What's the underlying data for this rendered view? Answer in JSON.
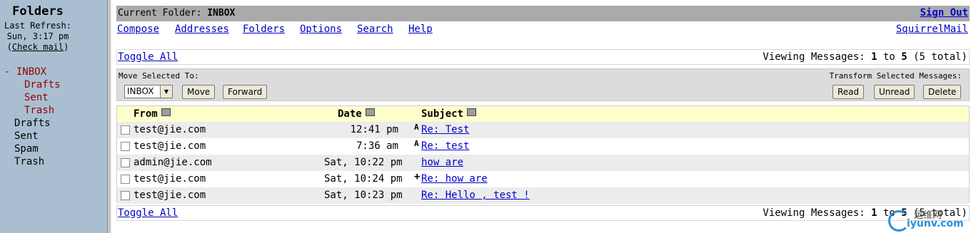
{
  "sidebar": {
    "title": "Folders",
    "last_refresh_label": "Last Refresh:",
    "last_refresh_time": "Sun, 3:17 pm",
    "check_mail_open": "(",
    "check_mail_label": "Check mail",
    "check_mail_close": ")",
    "folders": [
      {
        "prefix": "- ",
        "label": "INBOX",
        "current": true
      },
      {
        "prefix": "",
        "label": "Drafts",
        "current": false
      },
      {
        "prefix": "",
        "label": "Sent",
        "current": false
      },
      {
        "prefix": "",
        "label": "Trash",
        "current": false
      },
      {
        "prefix": "",
        "label": "Drafts",
        "current": false
      },
      {
        "prefix": "",
        "label": "Sent",
        "current": false
      },
      {
        "prefix": "",
        "label": "Spam",
        "current": false
      },
      {
        "prefix": "",
        "label": "Trash",
        "current": false
      }
    ]
  },
  "header": {
    "current_folder_label": "Current Folder:",
    "current_folder": "INBOX",
    "sign_out": "Sign Out",
    "nav": [
      "Compose",
      "Addresses",
      "Folders",
      "Options",
      "Search",
      "Help"
    ],
    "brand_link": "SquirrelMail"
  },
  "list_controls": {
    "toggle_all": "Toggle All",
    "viewing_prefix": "Viewing Messages: ",
    "viewing_from": "1",
    "viewing_to_word": " to ",
    "viewing_to": "5",
    "viewing_total": " (5 total)"
  },
  "operations": {
    "move_label": "Move Selected To:",
    "move_target": "INBOX",
    "move_button": "Move",
    "forward_button": "Forward",
    "transform_label": "Transform Selected Messages:",
    "read_button": "Read",
    "unread_button": "Unread",
    "delete_button": "Delete"
  },
  "table": {
    "headers": {
      "from": "From",
      "date": "Date",
      "subject": "Subject"
    },
    "rows": [
      {
        "from": "test@jie.com",
        "date": "12:41 pm",
        "flag": "A",
        "subject": "Re: Test",
        "shaded": true
      },
      {
        "from": "test@jie.com",
        "date": "7:36 am",
        "flag": "A",
        "subject": "Re: test",
        "shaded": false
      },
      {
        "from": "admin@jie.com",
        "date": "Sat, 10:22 pm",
        "flag": "",
        "subject": "how are",
        "shaded": true
      },
      {
        "from": "test@jie.com",
        "date": "Sat, 10:24 pm",
        "flag": "+",
        "subject": "Re: how are",
        "shaded": false
      },
      {
        "from": "test@jie.com",
        "date": "Sat, 10:23 pm",
        "flag": "",
        "subject": "Re: Hello , test !",
        "shaded": true
      }
    ]
  },
  "watermark": {
    "line1": "运维网",
    "line2": "iyunv.com"
  },
  "colors": {
    "sidebar_bg": "#a9bfd1",
    "title_bar": "#aaaaaa",
    "list_header": "#ffffcc",
    "link": "#0000cc",
    "current_folder": "#990000"
  }
}
